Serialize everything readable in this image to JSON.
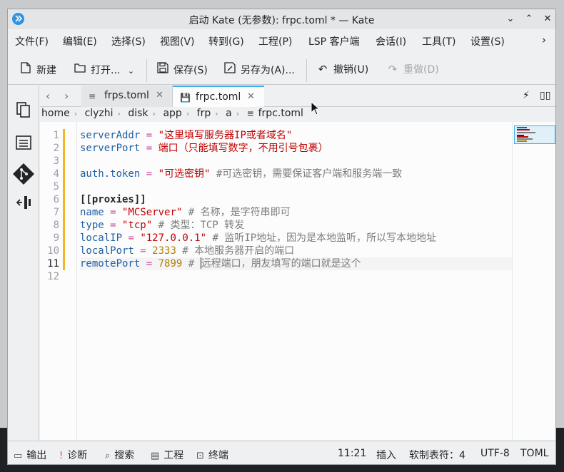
{
  "window": {
    "title": "启动 Kate (无参数): frpc.toml * — Kate",
    "controls": {
      "minimize": "⌄",
      "maximize": "⌃",
      "close": "✕"
    }
  },
  "menu": {
    "items": [
      "文件(F)",
      "编辑(E)",
      "选择(S)",
      "视图(V)",
      "转到(G)",
      "工程(P)",
      "LSP 客户端",
      "会话(I)",
      "工具(T)",
      "设置(S)"
    ],
    "more": "›"
  },
  "toolbar": {
    "new_label": "新建",
    "open_label": "打开...",
    "save_label": "保存(S)",
    "save_as_label": "另存为(A)...",
    "undo_label": "撤销(U)",
    "redo_label": "重做(D)"
  },
  "tabs": [
    {
      "label": "frps.toml",
      "active": false
    },
    {
      "label": "frpc.toml",
      "active": true
    }
  ],
  "breadcrumb": [
    "home",
    "clyzhi",
    "disk",
    "app",
    "frp",
    "a",
    "frpc.toml"
  ],
  "editor": {
    "line_numbers": [
      "1",
      "2",
      "3",
      "4",
      "5",
      "6",
      "7",
      "8",
      "9",
      "10",
      "11",
      "12"
    ],
    "current_line": 11,
    "lines": [
      {
        "key": "serverAddr",
        "op": " = ",
        "val": "\"这里填写服务器IP或者域名\"",
        "val_type": "s",
        "comment": ""
      },
      {
        "key": "serverPort",
        "op": " = ",
        "val": "端口（只能填写数字，不用引号包裹）",
        "val_type": "s",
        "comment": ""
      },
      {
        "key": "",
        "op": "",
        "val": "",
        "val_type": "",
        "comment": ""
      },
      {
        "key": "auth.token",
        "op": " = ",
        "val": "\"可选密钥\"",
        "val_type": "s",
        "comment": " #可选密钥，需要保证客户端和服务端一致"
      },
      {
        "key": "",
        "op": "",
        "val": "",
        "val_type": "",
        "comment": ""
      },
      {
        "section": "[[proxies]]"
      },
      {
        "key": "name",
        "op": " = ",
        "val": "\"MCServer\"",
        "val_type": "s",
        "comment": " # 名称，是字符串即可"
      },
      {
        "key": "type",
        "op": " = ",
        "val": "\"tcp\"",
        "val_type": "s",
        "comment": " # 类型：TCP 转发"
      },
      {
        "key": "localIP",
        "op": " = ",
        "val": "\"127.0.0.1\"",
        "val_type": "s",
        "comment": " # 监听IP地址，因为是本地监听，所以写本地地址"
      },
      {
        "key": "localPort",
        "op": " = ",
        "val": "2333",
        "val_type": "n",
        "comment": " # 本地服务器开启的端口"
      },
      {
        "key": "remotePort",
        "op": " = ",
        "val": "7899",
        "val_type": "n",
        "comment": " # ",
        "comment_after_cursor": "远程端口，朋友填写的端口就是这个"
      },
      {
        "key": "",
        "op": "",
        "val": "",
        "val_type": "",
        "comment": ""
      }
    ]
  },
  "statusbar": {
    "output": "输出",
    "diagnostics": "诊断",
    "search": "搜索",
    "project": "工程",
    "terminal": "终端",
    "cursor_pos": "11:21",
    "mode": "插入",
    "indent": "软制表符：4",
    "encoding": "UTF-8",
    "filetype": "TOML"
  },
  "colors": {
    "accent": "#3daee9",
    "modified_marker": "#f6b426",
    "key": "#1f5fa6",
    "string": "#bf0303",
    "number": "#b08000",
    "comment": "#7a7c7f"
  }
}
